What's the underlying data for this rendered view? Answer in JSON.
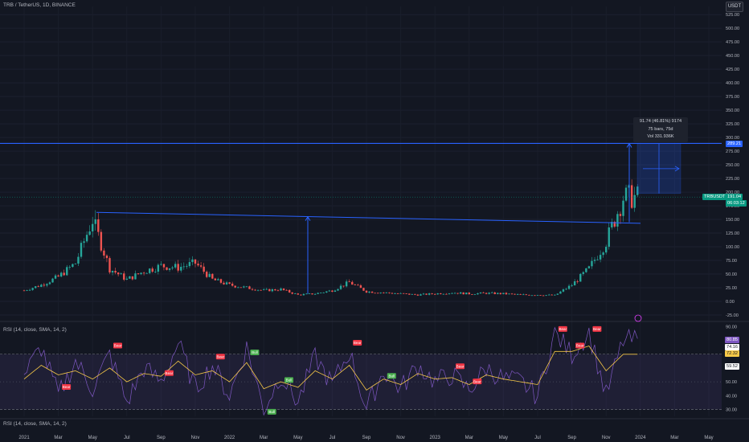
{
  "header": {
    "symbol_line": "TRB / TetherUS, 1D, BINANCE",
    "currency_button": "USDT",
    "rsi_label_top": "RSI (14, close, SMA, 14, 2)",
    "rsi_label_bottom": "RSI (14, close, SMA, 14, 2)"
  },
  "measure_tooltip": {
    "line1": "91.74 (46.81%) 9174",
    "line2": "75 bars, 75d",
    "line3": "Vol 331.936K"
  },
  "price_tags": {
    "target_price": "289.21",
    "symbol_tag": "TRBUSDT",
    "current_price": "191.04",
    "countdown": "06:03:12"
  },
  "rsi_tags": {
    "rsi_value": "80.85",
    "rsi_a": "74.16",
    "rsi_b": "72.32",
    "rsi_sma": "59.52"
  },
  "colors": {
    "background": "#131722",
    "candle_up": "#26a69a",
    "candle_down": "#ef5350",
    "drawing": "#2962ff",
    "rsi_line": "#7e57c2",
    "rsi_sma": "#f7c948",
    "bear_label": "#f23645",
    "bull_label": "#4caf50"
  },
  "chart_data": [
    {
      "type": "line",
      "subtype": "candlestick",
      "title": "TRB / TetherUS, 1D, BINANCE",
      "x_tick_labels": [
        "2021",
        "Mar",
        "May",
        "Jul",
        "Sep",
        "Nov",
        "2022",
        "Mar",
        "May",
        "Jul",
        "Sep",
        "Nov",
        "2023",
        "Mar",
        "May",
        "Jul",
        "Sep",
        "Nov",
        "2024",
        "Mar",
        "May"
      ],
      "y_tick_labels": [
        "-25.00",
        "0.00",
        "25.00",
        "50.00",
        "75.00",
        "100.00",
        "125.00",
        "150.00",
        "175.00",
        "200.00",
        "225.00",
        "250.00",
        "275.00",
        "300.00",
        "325.00",
        "350.00",
        "375.00",
        "400.00",
        "425.00",
        "450.00",
        "475.00",
        "500.00",
        "525.00"
      ],
      "ylim": [
        -25,
        540
      ],
      "series": [
        {
          "values": [
            [
              "2021-01",
              20
            ],
            [
              "2021-02",
              30
            ],
            [
              "2021-03",
              45
            ],
            [
              "2021-04",
              70
            ],
            [
              "2021-05",
              150
            ],
            [
              "2021-06",
              60
            ],
            [
              "2021-07",
              40
            ],
            [
              "2021-08",
              55
            ],
            [
              "2021-09",
              65
            ],
            [
              "2021-10",
              62
            ],
            [
              "2021-11",
              70
            ],
            [
              "2021-12",
              40
            ],
            [
              "2022-01",
              30
            ],
            [
              "2022-02",
              25
            ],
            [
              "2022-03",
              20
            ],
            [
              "2022-04",
              22
            ],
            [
              "2022-05",
              12
            ],
            [
              "2022-06",
              14
            ],
            [
              "2022-07",
              20
            ],
            [
              "2022-08",
              35
            ],
            [
              "2022-09",
              18
            ],
            [
              "2022-10",
              16
            ],
            [
              "2022-11",
              14
            ],
            [
              "2022-12",
              12
            ],
            [
              "2023-01",
              14
            ],
            [
              "2023-02",
              16
            ],
            [
              "2023-03",
              14
            ],
            [
              "2023-04",
              15
            ],
            [
              "2023-05",
              14
            ],
            [
              "2023-06",
              12
            ],
            [
              "2023-07",
              12
            ],
            [
              "2023-08",
              11
            ],
            [
              "2023-09",
              30
            ],
            [
              "2023-10",
              60
            ],
            [
              "2023-11",
              110
            ],
            [
              "2023-12",
              191
            ]
          ]
        }
      ],
      "annotations": [
        "Descending trendline from the May 2021 high (~165) to ~140 in Dec 2023",
        "Horizontal target line at 289.21",
        "Measured move arrow and long projection box (91.74 (46.81%))"
      ]
    },
    {
      "type": "line",
      "title": "RSI (14, close, SMA, 14, 2)",
      "y_tick_labels": [
        "30.00",
        "40.00",
        "50.00",
        "60.00",
        "70.00",
        "80.00",
        "90.00"
      ],
      "ylim": [
        25,
        92
      ],
      "bands": [
        30,
        70
      ],
      "series": [
        {
          "name": "RSI",
          "values": [
            55,
            75,
            40,
            65,
            45,
            70,
            35,
            60,
            50,
            78,
            45,
            62,
            40,
            75,
            30,
            55,
            35,
            68,
            48,
            72,
            30,
            58,
            45,
            62,
            50,
            55,
            44,
            60,
            52,
            50,
            40,
            85,
            70,
            86,
            40,
            80
          ]
        },
        {
          "name": "RSI SMA",
          "values": [
            52,
            62,
            55,
            58,
            52,
            60,
            50,
            56,
            54,
            65,
            55,
            58,
            50,
            64,
            45,
            50,
            46,
            58,
            52,
            62,
            44,
            52,
            48,
            56,
            52,
            53,
            48,
            55,
            52,
            50,
            48,
            72,
            72,
            76,
            58,
            70
          ]
        }
      ],
      "labels": [
        {
          "text": "Bear",
          "i": 2
        },
        {
          "text": "Bear",
          "i": 5
        },
        {
          "text": "Bear",
          "i": 8
        },
        {
          "text": "Bear",
          "i": 11
        },
        {
          "text": "Bull",
          "i": 13
        },
        {
          "text": "Bull",
          "i": 14
        },
        {
          "text": "Bull",
          "i": 15
        },
        {
          "text": "Bear",
          "i": 19
        },
        {
          "text": "Bull",
          "i": 21
        },
        {
          "text": "Bear",
          "i": 25
        },
        {
          "text": "Bear",
          "i": 26
        },
        {
          "text": "Bear",
          "i": 31
        },
        {
          "text": "Bear",
          "i": 32
        },
        {
          "text": "Bear",
          "i": 33
        }
      ]
    }
  ]
}
